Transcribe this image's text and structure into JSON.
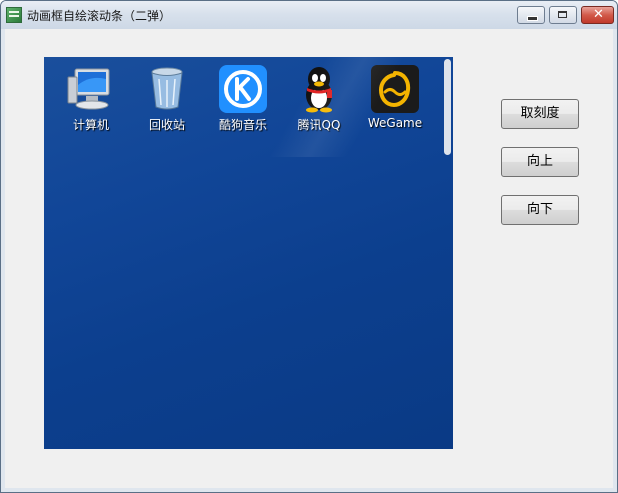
{
  "window": {
    "title": "动画框自绘滚动条（二弹）",
    "buttons": {
      "minimize_icon": "minimize-icon",
      "maximize_icon": "maximize-icon",
      "close_icon": "close-icon",
      "close_glyph": "✕"
    }
  },
  "desktop": {
    "icons": [
      {
        "label": "计算机",
        "icon": "computer-icon"
      },
      {
        "label": "回收站",
        "icon": "recycle-bin-icon"
      },
      {
        "label": "酷狗音乐",
        "icon": "kugou-music-icon"
      },
      {
        "label": "腾讯QQ",
        "icon": "qq-icon"
      },
      {
        "label": "WeGame",
        "icon": "wegame-icon"
      }
    ]
  },
  "side_buttons": {
    "calibrate": "取刻度",
    "up": "向上",
    "down": "向下"
  },
  "colors": {
    "desktop": "#0f4590",
    "kugou": "#2190ff",
    "wegame_bg": "#1b1b1b",
    "wegame_accent": "#f4b400"
  }
}
